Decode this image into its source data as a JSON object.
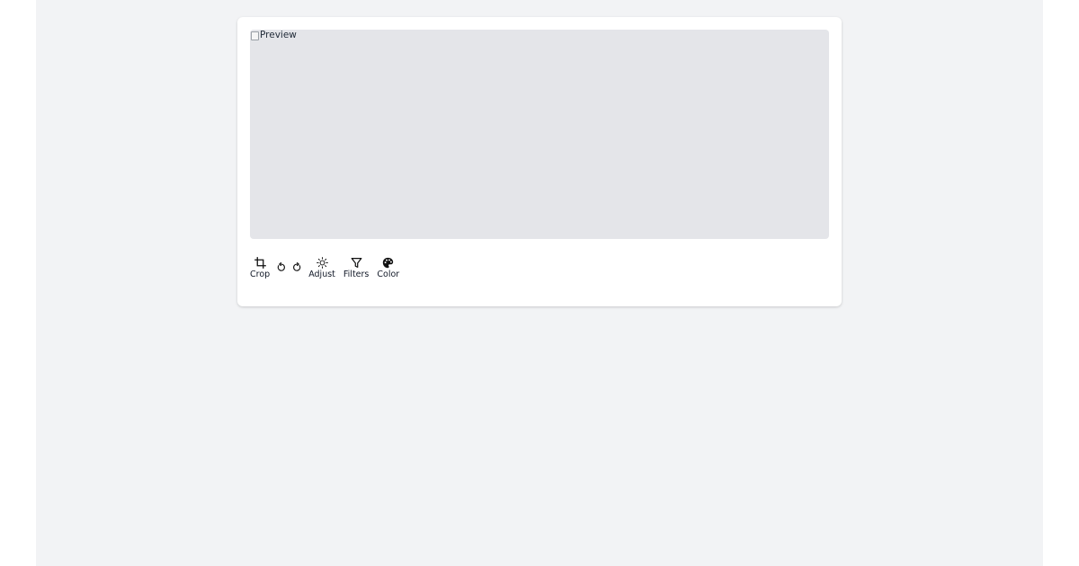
{
  "preview": {
    "alt": "Preview"
  },
  "toolbar": {
    "crop_label": "Crop",
    "adjust_label": "Adjust",
    "filters_label": "Filters",
    "color_label": "Color"
  },
  "icons": {
    "crop": "crop-icon",
    "rotate_left": "rotate-left-icon",
    "rotate_right": "rotate-right-icon",
    "adjust": "sun-icon",
    "filters": "funnel-icon",
    "color": "palette-icon"
  },
  "colors": {
    "page_background": "#f2f3f5",
    "card_background": "#ffffff",
    "preview_background": "#e4e5e9",
    "text": "#111827"
  }
}
